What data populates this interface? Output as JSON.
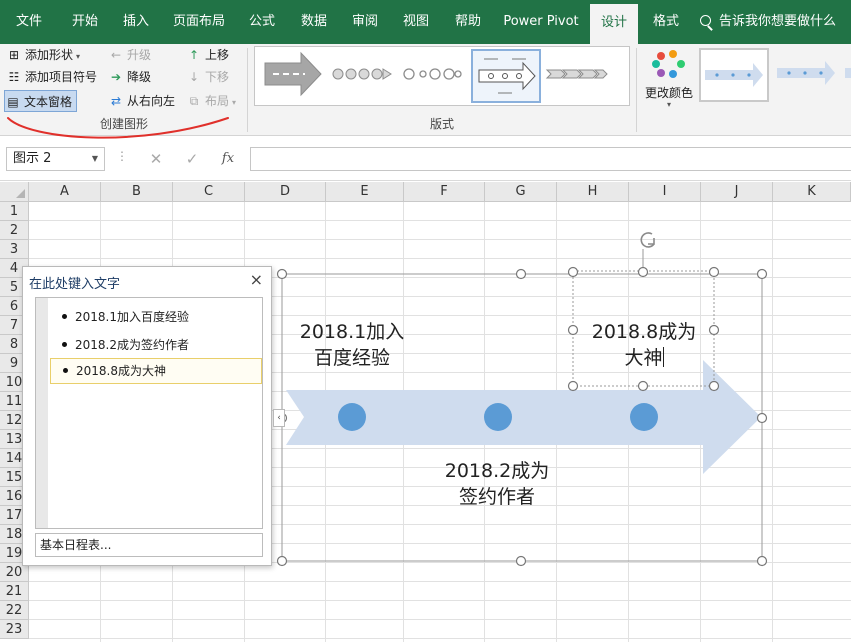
{
  "tabs": [
    "文件",
    "开始",
    "插入",
    "页面布局",
    "公式",
    "数据",
    "审阅",
    "视图",
    "帮助",
    "Power Pivot",
    "设计",
    "格式"
  ],
  "active_tab": "设计",
  "tell_me": "告诉我你想要做什么",
  "ribbon": {
    "create_graphic": {
      "add_shape": "添加形状",
      "add_bullet": "添加项目符号",
      "text_pane": "文本窗格",
      "promote": "升级",
      "demote": "降级",
      "right_to_left": "从右向左",
      "move_up": "上移",
      "move_down": "下移",
      "layout": "布局",
      "label": "创建图形"
    },
    "layouts_label": "版式",
    "change_colors": "更改颜色"
  },
  "formula_bar": {
    "name_box": "图示 2",
    "fx": "fx",
    "cancel": "✕",
    "enter": "✓"
  },
  "grid": {
    "columns": [
      "A",
      "B",
      "C",
      "D",
      "E",
      "F",
      "G",
      "H",
      "I",
      "J",
      "K"
    ],
    "rows": [
      "1",
      "2",
      "3",
      "4",
      "5",
      "6",
      "7",
      "8",
      "9",
      "10",
      "11",
      "12",
      "13",
      "14",
      "15",
      "16",
      "17",
      "18",
      "19",
      "20",
      "21",
      "22",
      "23"
    ]
  },
  "text_pane": {
    "title": "在此处键入文字",
    "close": "×",
    "items": [
      "2018.1加入百度经验",
      "2018.2成为签约作者",
      "2018.8成为大神"
    ],
    "selected_index": 2,
    "footer": "基本日程表..."
  },
  "smartart": {
    "label1_line1": "2018.1加入",
    "label1_line2": "百度经验",
    "label2_line1": "2018.2成为",
    "label2_line2": "签约作者",
    "label3_line1": "2018.8成为",
    "label3_line2": "大神",
    "colors": {
      "arrow": "#cfdcee",
      "circle": "#5b9bd5",
      "accent": "#217346"
    }
  }
}
